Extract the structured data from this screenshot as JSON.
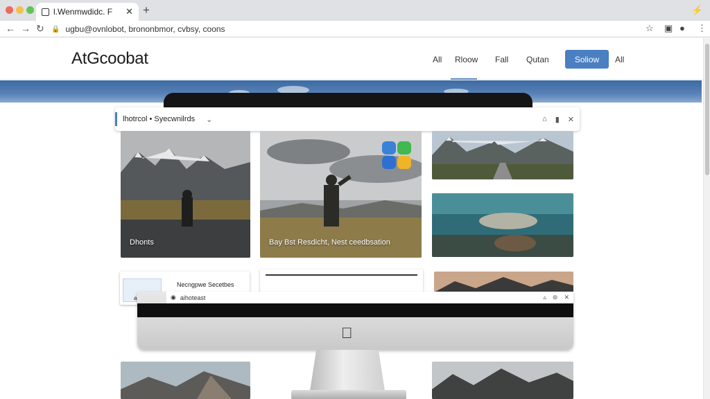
{
  "browser": {
    "tab_title": "l.Wenmwdidc. F",
    "tab_close": "✕",
    "new_tab": "+",
    "url": "ugbu@ovnlobot, brononbmor, cvbsy, coons",
    "extension_icon": "puzzle-icon"
  },
  "site": {
    "logo": "AtGcoobat",
    "nav": [
      {
        "label": "All"
      },
      {
        "label": "Rloow"
      },
      {
        "label": "Fall"
      },
      {
        "label": "Qutan"
      }
    ],
    "cta_label": "Soliow",
    "nav_extra": "All",
    "active_nav_index": 1
  },
  "toolbar": {
    "breadcrumb": "lhotrcol  •  Syecwnilrds"
  },
  "gallery": {
    "card1_caption": "Dhonts",
    "card2_caption": "Bay Bst Resdicht, Nest ceedbsation"
  },
  "mini_window": {
    "label": "Necngpwe Secetbes",
    "sublabel": "aisb",
    "inner_label": "aihoteast"
  },
  "colors": {
    "accent": "#4a7fc1",
    "hero": "#3d6aa3"
  }
}
